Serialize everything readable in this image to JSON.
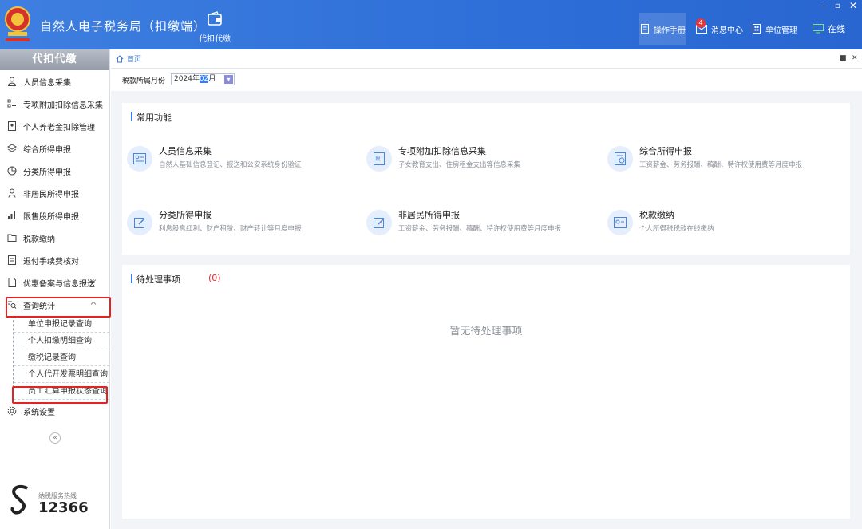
{
  "header": {
    "app_title": "自然人电子税务局（扣缴端）",
    "tool_label": "代扣代缴",
    "manual_label": "操作手册",
    "message_label": "消息中心",
    "message_badge": "4",
    "unit_label": "单位管理",
    "online_label": "在线"
  },
  "sidebar": {
    "title": "代扣代缴",
    "items": [
      {
        "label": "人员信息采集"
      },
      {
        "label": "专项附加扣除信息采集"
      },
      {
        "label": "个人养老金扣除管理"
      },
      {
        "label": "综合所得申报"
      },
      {
        "label": "分类所得申报"
      },
      {
        "label": "非居民所得申报"
      },
      {
        "label": "限售股所得申报"
      },
      {
        "label": "税款缴纳"
      },
      {
        "label": "退付手续费核对"
      },
      {
        "label": "优惠备案与信息报送"
      },
      {
        "label": "查询统计"
      }
    ],
    "sub_items": [
      {
        "label": "单位申报记录查询"
      },
      {
        "label": "个人扣缴明细查询"
      },
      {
        "label": "缴税记录查询"
      },
      {
        "label": "个人代开发票明细查询"
      },
      {
        "label": "员工汇算申报状态查询"
      }
    ],
    "settings_label": "系统设置",
    "hotline_label": "纳税服务热线",
    "hotline_number": "12366"
  },
  "main": {
    "breadcrumb": "首页",
    "period_label": "税款所属月份",
    "period_year": "2024年",
    "period_month": "02",
    "period_suffix": "月",
    "common_title": "常用功能",
    "functions": [
      {
        "title": "人员信息采集",
        "desc": "自然人基础信息登记、报送和公安系统身份验证"
      },
      {
        "title": "专项附加扣除信息采集",
        "desc": "子女教育支出、住房租金支出等信息采集"
      },
      {
        "title": "综合所得申报",
        "desc": "工资薪金、劳务报酬、稿酬、特许权使用费等月度申报"
      },
      {
        "title": "分类所得申报",
        "desc": "利息股息红利、财产租赁、财产转让等月度申报"
      },
      {
        "title": "非居民所得申报",
        "desc": "工资薪金、劳务报酬、稿酬、特许权使用费等月度申报"
      },
      {
        "title": "税款缴纳",
        "desc": "个人所得税税款在线缴纳"
      }
    ],
    "pending_title": "待处理事项",
    "pending_count": "(0)",
    "empty_text": "暂无待处理事项"
  },
  "colors": {
    "header_blue": "#2d6ed8",
    "accent_blue": "#3b7de4",
    "highlight_red": "#e32222"
  }
}
